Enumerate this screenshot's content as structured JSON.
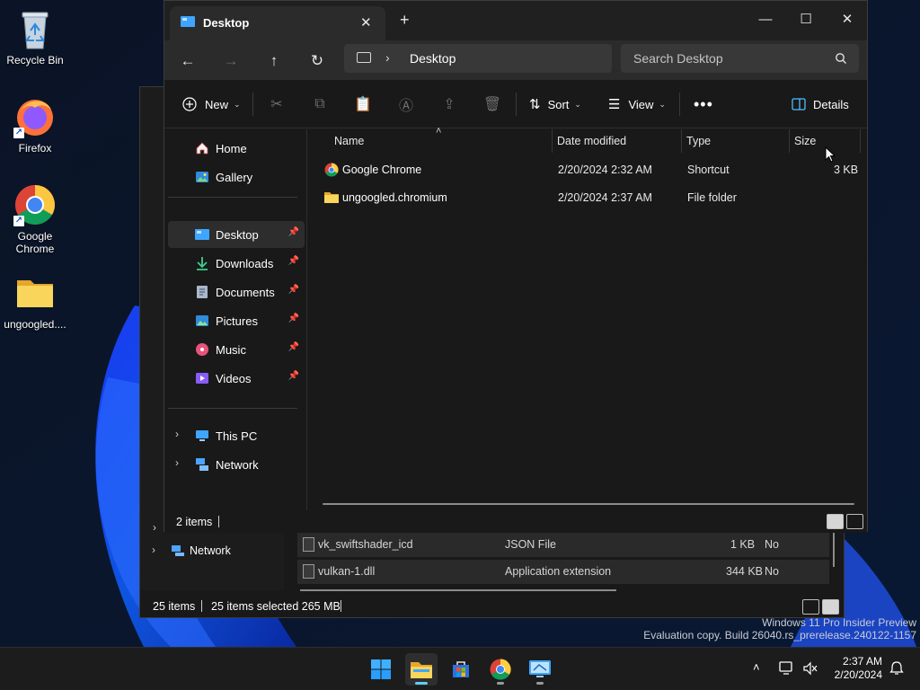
{
  "desktop": {
    "icons": [
      {
        "label": "Recycle Bin",
        "icon": "recycle-bin-icon"
      },
      {
        "label": "Firefox",
        "icon": "firefox-icon"
      },
      {
        "label": "Google Chrome",
        "icon": "chrome-icon"
      },
      {
        "label": "ungoogled....",
        "icon": "folder-icon"
      }
    ]
  },
  "background_window": {
    "nav_network": "Network",
    "rows": [
      {
        "name": "vk_swiftshader_icd",
        "type": "JSON File",
        "size": "1 KB",
        "extra": "No"
      },
      {
        "name": "vulkan-1.dll",
        "type": "Application extension",
        "size": "344 KB",
        "extra": "No"
      }
    ],
    "status": {
      "items": "25 items",
      "selected": "25 items selected 265 MB"
    }
  },
  "explorer": {
    "tab_title": "Desktop",
    "address": {
      "crumb": "Desktop"
    },
    "search": {
      "placeholder": "Search Desktop"
    },
    "toolbar": {
      "new_label": "New",
      "sort_label": "Sort",
      "view_label": "View",
      "details_label": "Details"
    },
    "nav": {
      "top": [
        {
          "label": "Home",
          "icon": "home-icon"
        },
        {
          "label": "Gallery",
          "icon": "gallery-icon"
        }
      ],
      "pinned": [
        {
          "label": "Desktop",
          "icon": "desktop-icon",
          "selected": true
        },
        {
          "label": "Downloads",
          "icon": "downloads-icon"
        },
        {
          "label": "Documents",
          "icon": "documents-icon"
        },
        {
          "label": "Pictures",
          "icon": "pictures-icon"
        },
        {
          "label": "Music",
          "icon": "music-icon"
        },
        {
          "label": "Videos",
          "icon": "videos-icon"
        }
      ],
      "bottom": [
        {
          "label": "This PC",
          "icon": "this-pc-icon"
        },
        {
          "label": "Network",
          "icon": "network-icon"
        }
      ]
    },
    "columns": {
      "name": "Name",
      "date": "Date modified",
      "type": "Type",
      "size": "Size"
    },
    "files": [
      {
        "name": "Google Chrome",
        "date": "2/20/2024 2:32 AM",
        "type": "Shortcut",
        "size": "3 KB",
        "icon": "chrome-icon"
      },
      {
        "name": "ungoogled.chromium",
        "date": "2/20/2024 2:37 AM",
        "type": "File folder",
        "size": "",
        "icon": "folder-icon"
      }
    ],
    "status": {
      "count": "2 items"
    }
  },
  "watermark": {
    "line1": "Windows 11 Pro Insider Preview",
    "line2": "Evaluation copy. Build 26040.rs_prerelease.240122-1157"
  },
  "taskbar": {
    "apps": [
      "start-icon",
      "file-explorer-icon",
      "store-icon",
      "chrome-icon",
      "remote-desktop-icon"
    ],
    "clock": {
      "time": "2:37 AM",
      "date": "2/20/2024"
    }
  },
  "colors": {
    "accent": "#60cdff",
    "folder": "#f3c744",
    "window_bg": "#191919"
  }
}
